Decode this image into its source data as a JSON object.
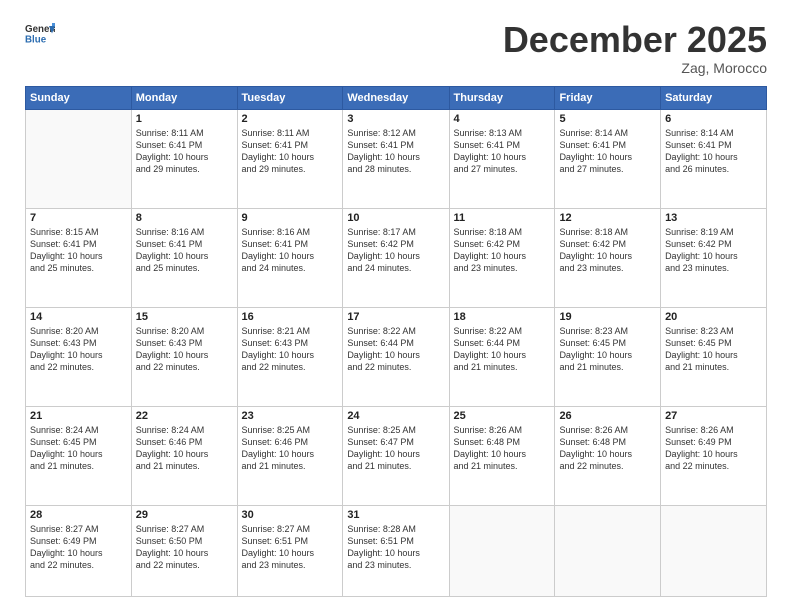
{
  "header": {
    "logo_general": "General",
    "logo_blue": "Blue",
    "title": "December 2025",
    "location": "Zag, Morocco"
  },
  "days_of_week": [
    "Sunday",
    "Monday",
    "Tuesday",
    "Wednesday",
    "Thursday",
    "Friday",
    "Saturday"
  ],
  "weeks": [
    [
      {
        "day": "",
        "info": ""
      },
      {
        "day": "1",
        "info": "Sunrise: 8:11 AM\nSunset: 6:41 PM\nDaylight: 10 hours\nand 29 minutes."
      },
      {
        "day": "2",
        "info": "Sunrise: 8:11 AM\nSunset: 6:41 PM\nDaylight: 10 hours\nand 29 minutes."
      },
      {
        "day": "3",
        "info": "Sunrise: 8:12 AM\nSunset: 6:41 PM\nDaylight: 10 hours\nand 28 minutes."
      },
      {
        "day": "4",
        "info": "Sunrise: 8:13 AM\nSunset: 6:41 PM\nDaylight: 10 hours\nand 27 minutes."
      },
      {
        "day": "5",
        "info": "Sunrise: 8:14 AM\nSunset: 6:41 PM\nDaylight: 10 hours\nand 27 minutes."
      },
      {
        "day": "6",
        "info": "Sunrise: 8:14 AM\nSunset: 6:41 PM\nDaylight: 10 hours\nand 26 minutes."
      }
    ],
    [
      {
        "day": "7",
        "info": "Sunrise: 8:15 AM\nSunset: 6:41 PM\nDaylight: 10 hours\nand 25 minutes."
      },
      {
        "day": "8",
        "info": "Sunrise: 8:16 AM\nSunset: 6:41 PM\nDaylight: 10 hours\nand 25 minutes."
      },
      {
        "day": "9",
        "info": "Sunrise: 8:16 AM\nSunset: 6:41 PM\nDaylight: 10 hours\nand 24 minutes."
      },
      {
        "day": "10",
        "info": "Sunrise: 8:17 AM\nSunset: 6:42 PM\nDaylight: 10 hours\nand 24 minutes."
      },
      {
        "day": "11",
        "info": "Sunrise: 8:18 AM\nSunset: 6:42 PM\nDaylight: 10 hours\nand 23 minutes."
      },
      {
        "day": "12",
        "info": "Sunrise: 8:18 AM\nSunset: 6:42 PM\nDaylight: 10 hours\nand 23 minutes."
      },
      {
        "day": "13",
        "info": "Sunrise: 8:19 AM\nSunset: 6:42 PM\nDaylight: 10 hours\nand 23 minutes."
      }
    ],
    [
      {
        "day": "14",
        "info": "Sunrise: 8:20 AM\nSunset: 6:43 PM\nDaylight: 10 hours\nand 22 minutes."
      },
      {
        "day": "15",
        "info": "Sunrise: 8:20 AM\nSunset: 6:43 PM\nDaylight: 10 hours\nand 22 minutes."
      },
      {
        "day": "16",
        "info": "Sunrise: 8:21 AM\nSunset: 6:43 PM\nDaylight: 10 hours\nand 22 minutes."
      },
      {
        "day": "17",
        "info": "Sunrise: 8:22 AM\nSunset: 6:44 PM\nDaylight: 10 hours\nand 22 minutes."
      },
      {
        "day": "18",
        "info": "Sunrise: 8:22 AM\nSunset: 6:44 PM\nDaylight: 10 hours\nand 21 minutes."
      },
      {
        "day": "19",
        "info": "Sunrise: 8:23 AM\nSunset: 6:45 PM\nDaylight: 10 hours\nand 21 minutes."
      },
      {
        "day": "20",
        "info": "Sunrise: 8:23 AM\nSunset: 6:45 PM\nDaylight: 10 hours\nand 21 minutes."
      }
    ],
    [
      {
        "day": "21",
        "info": "Sunrise: 8:24 AM\nSunset: 6:45 PM\nDaylight: 10 hours\nand 21 minutes."
      },
      {
        "day": "22",
        "info": "Sunrise: 8:24 AM\nSunset: 6:46 PM\nDaylight: 10 hours\nand 21 minutes."
      },
      {
        "day": "23",
        "info": "Sunrise: 8:25 AM\nSunset: 6:46 PM\nDaylight: 10 hours\nand 21 minutes."
      },
      {
        "day": "24",
        "info": "Sunrise: 8:25 AM\nSunset: 6:47 PM\nDaylight: 10 hours\nand 21 minutes."
      },
      {
        "day": "25",
        "info": "Sunrise: 8:26 AM\nSunset: 6:48 PM\nDaylight: 10 hours\nand 21 minutes."
      },
      {
        "day": "26",
        "info": "Sunrise: 8:26 AM\nSunset: 6:48 PM\nDaylight: 10 hours\nand 22 minutes."
      },
      {
        "day": "27",
        "info": "Sunrise: 8:26 AM\nSunset: 6:49 PM\nDaylight: 10 hours\nand 22 minutes."
      }
    ],
    [
      {
        "day": "28",
        "info": "Sunrise: 8:27 AM\nSunset: 6:49 PM\nDaylight: 10 hours\nand 22 minutes."
      },
      {
        "day": "29",
        "info": "Sunrise: 8:27 AM\nSunset: 6:50 PM\nDaylight: 10 hours\nand 22 minutes."
      },
      {
        "day": "30",
        "info": "Sunrise: 8:27 AM\nSunset: 6:51 PM\nDaylight: 10 hours\nand 23 minutes."
      },
      {
        "day": "31",
        "info": "Sunrise: 8:28 AM\nSunset: 6:51 PM\nDaylight: 10 hours\nand 23 minutes."
      },
      {
        "day": "",
        "info": ""
      },
      {
        "day": "",
        "info": ""
      },
      {
        "day": "",
        "info": ""
      }
    ]
  ]
}
